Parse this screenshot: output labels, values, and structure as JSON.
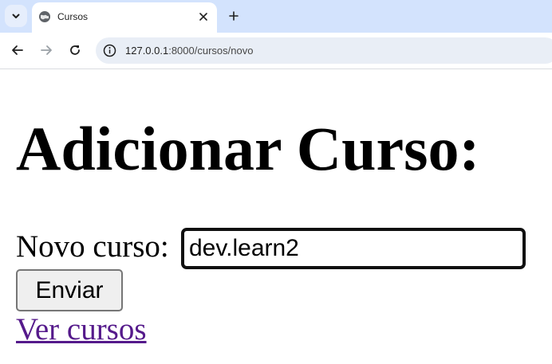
{
  "browser": {
    "tab": {
      "title": "Cursos"
    },
    "address": {
      "host": "127.0.0.1",
      "rest": ":8000/cursos/novo"
    }
  },
  "page": {
    "heading": "Adicionar Curso:",
    "form": {
      "label": "Novo curso:",
      "input_value": "dev.learn2",
      "submit_label": "Enviar"
    },
    "link_label": "Ver cursos"
  },
  "colors": {
    "tabstrip": "#d3e3fd",
    "omnibox": "#e9eef6",
    "visited_link": "#551a8b"
  }
}
